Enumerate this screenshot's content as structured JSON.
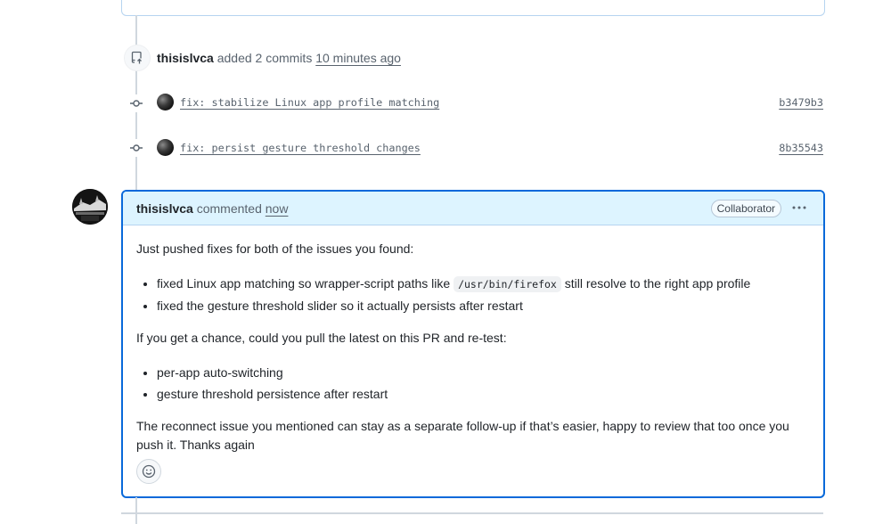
{
  "push_event": {
    "user": "thisislvca",
    "action": "added 2 commits",
    "time": "10 minutes ago",
    "icon": "repo-push-icon"
  },
  "commits": [
    {
      "message": "fix: stabilize Linux app profile matching",
      "sha": "b3479b3"
    },
    {
      "message": "fix: persist gesture threshold changes",
      "sha": "8b35543"
    }
  ],
  "comment": {
    "author": "thisislvca",
    "action": "commented",
    "time": "now",
    "role_badge": "Collaborator",
    "body": {
      "intro": "Just pushed fixes for both of the issues you found:",
      "list1_item1_before": "fixed Linux app matching so wrapper-script paths like ",
      "list1_item1_code": "/usr/bin/firefox",
      "list1_item1_after": " still resolve to the right app profile",
      "list1_item2": "fixed the gesture threshold slider so it actually persists after restart",
      "para2": "If you get a chance, could you pull the latest on this PR and re-test:",
      "list2_item1": "per-app auto-switching",
      "list2_item2": "gesture threshold persistence after restart",
      "para3": "The reconnect issue you mentioned can stay as a separate follow-up if that’s easier, happy to review that too once you push it. Thanks again"
    }
  },
  "colors": {
    "accent": "#0969da",
    "header_bg": "#ddf4ff",
    "muted_text": "#59636e"
  }
}
